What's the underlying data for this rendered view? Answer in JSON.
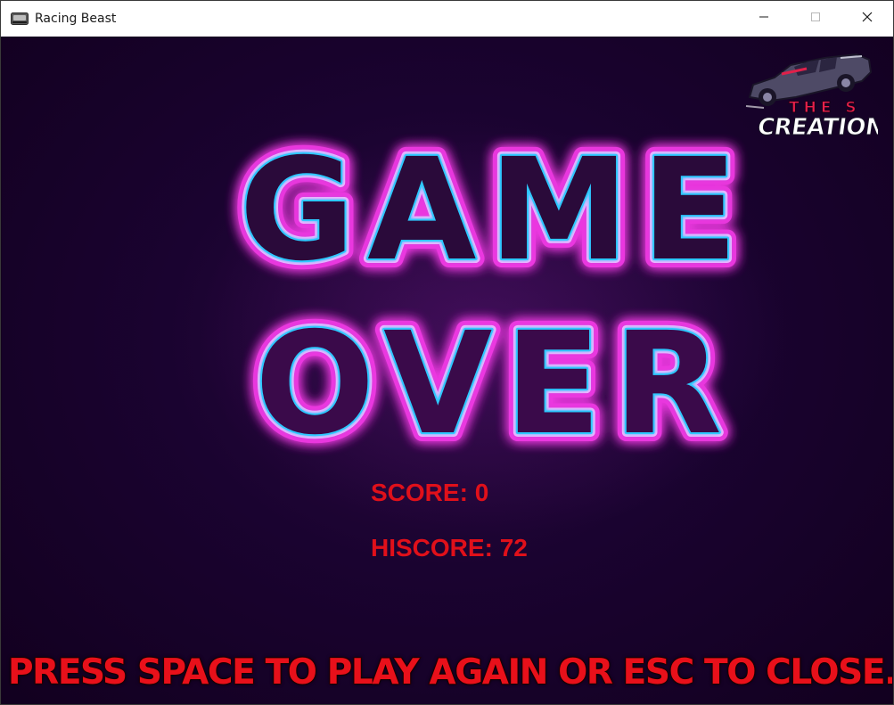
{
  "window": {
    "title": "Racing Beast",
    "minimize_icon": "minimize-icon",
    "maximize_icon": "maximize-icon",
    "close_icon": "close-icon"
  },
  "logo": {
    "line1": "THE S",
    "line2": "CREATION"
  },
  "game_over": {
    "line1": "GAME",
    "line2": "OVER"
  },
  "stats": {
    "score_label": "SCORE:",
    "score_value": "0",
    "hiscore_label": "HISCORE:",
    "hiscore_value": "72"
  },
  "prompt": "PRESS SPACE TO PLAY AGAIN OR ESC TO CLOSE.",
  "colors": {
    "background": "#14001e",
    "neon_outer": "#ff3df0",
    "neon_inner": "#2ec8ff",
    "score_text": "#e0101a",
    "prompt_text": "#e8101a"
  }
}
